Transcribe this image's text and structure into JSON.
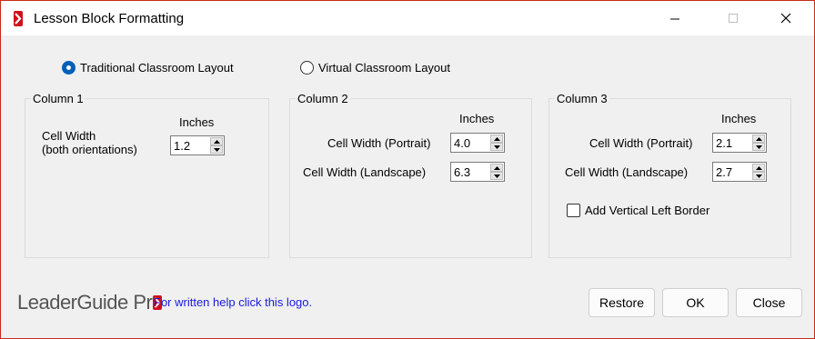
{
  "window": {
    "title": "Lesson Block Formatting",
    "accent_color": "#c42b1c",
    "icon": "leaderguide-app-icon"
  },
  "layout_options": {
    "traditional_label": "Traditional Classroom Layout",
    "traditional_selected": true,
    "virtual_label": "Virtual Classroom Layout",
    "virtual_selected": false
  },
  "column1": {
    "title": "Column 1",
    "units_label": "Inches",
    "cell_width_label_line1": "Cell  Width",
    "cell_width_label_line2": "(both orientations)",
    "cell_width_value": "1.2"
  },
  "column2": {
    "title": "Column 2",
    "units_label": "Inches",
    "portrait_label": "Cell Width (Portrait)",
    "portrait_value": "4.0",
    "landscape_label": "Cell Width (Landscape)",
    "landscape_value": "6.3"
  },
  "column3": {
    "title": "Column 3",
    "units_label": "Inches",
    "portrait_label": "Cell Width (Portrait)",
    "portrait_value": "2.1",
    "landscape_label": "Cell Width (Landscape)",
    "landscape_value": "2.7",
    "left_border_label": "Add Vertical Left Border",
    "left_border_checked": false
  },
  "footer": {
    "logo_text": "LeaderGuide Pr",
    "logo_color": "#d0101a",
    "help_text": "For written help click this logo.",
    "help_color": "#1a1adb",
    "restore_label": "Restore",
    "ok_label": "OK",
    "close_label": "Close"
  }
}
